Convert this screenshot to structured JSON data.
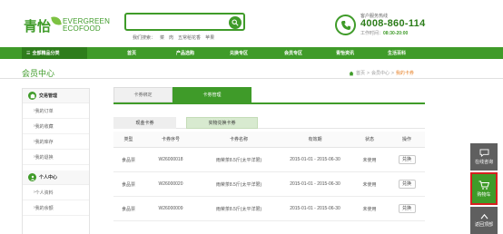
{
  "header": {
    "logo_cn": "青怡",
    "logo_en_line1": "EVERGREEN",
    "logo_en_line2": "ECOFOOD",
    "search": {
      "placeholder": ""
    },
    "hot_words_label": "我们搜索：",
    "hot_words": [
      "菜",
      "肉",
      "五常稻花香",
      "苹果"
    ],
    "hotline": {
      "label": "客户服务热线",
      "number": "4008-860-114",
      "hours_label": "工作时间：",
      "hours": "08:30-20:00"
    }
  },
  "nav": {
    "category_label": "全部精品分类",
    "items": [
      "首页",
      "产品选购",
      "兑换专区",
      "会员专区",
      "青怡资讯",
      "生活百科"
    ]
  },
  "page": {
    "title": "会员中心",
    "breadcrumb": [
      "首页",
      "会员中心",
      "我的卡券"
    ]
  },
  "sidebar": {
    "sections": [
      {
        "title": "交易管理",
        "items": [
          "我的订单",
          "我的收藏",
          "我的库存",
          "我的退换"
        ]
      },
      {
        "title": "个人中心",
        "items": [
          "个人资料",
          "我的余额"
        ]
      }
    ]
  },
  "tabs": [
    "卡券绑定",
    "卡劵管理"
  ],
  "subtabs": [
    "现金卡券",
    "实物兑换卡券"
  ],
  "table": {
    "headers": [
      "类型",
      "卡券序号",
      "卡券名称",
      "有效期",
      "状态",
      "操作"
    ],
    "rows": [
      {
        "type": "食品票",
        "serial": "W26000018",
        "name": "雨荣茶8.5斤(太平洋限)",
        "validity": "2015-01-01 - 2015-06-30",
        "status": "未使用",
        "action": "兑换"
      },
      {
        "type": "食品票",
        "serial": "W26000020",
        "name": "雨荣茶8.5斤(太平洋限)",
        "validity": "2015-01-01 - 2015-06-30",
        "status": "未使用",
        "action": "兑换"
      },
      {
        "type": "食品票",
        "serial": "W26000009",
        "name": "雨荣茶8.5斤(太平洋限)",
        "validity": "2015-01-01 - 2015-06-30",
        "status": "未使用",
        "action": "兑换"
      }
    ]
  },
  "float_bar": {
    "online_consult": "在线咨询",
    "cart": "购物车",
    "back_top": "返回顶部"
  },
  "colors": {
    "brand_green": "#3f9b29",
    "dark_green": "#2e7d1c",
    "breadcrumb_current": "#e8842c",
    "cart_border": "#d62020"
  }
}
